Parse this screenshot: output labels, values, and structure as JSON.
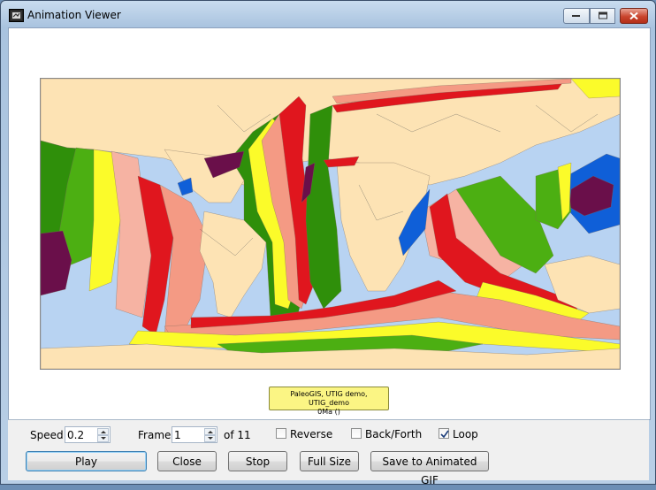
{
  "window": {
    "title": "Animation Viewer"
  },
  "map": {
    "caption_line1": "PaleoGIS, UTIG demo, UTIG_demo",
    "caption_line2": "0Ma  ()",
    "colors": {
      "ocean": "#b8d3f2",
      "continent": "#fde3b4",
      "red": "#e0161e",
      "salmon": "#f49a84",
      "pink": "#f6b3a3",
      "yellow": "#fbfb2a",
      "lightgreen": "#a6e04a",
      "green": "#4caf12",
      "darkgreen": "#2f8f0a",
      "blue": "#0f5fd8",
      "purple": "#6a0f4a"
    }
  },
  "controls": {
    "speed_label": "Speed:",
    "speed_value": "0.2",
    "frame_label": "Frame:",
    "frame_value": "1",
    "frame_total": "of 11",
    "reverse_label": "Reverse",
    "reverse_checked": false,
    "backforth_label": "Back/Forth",
    "backforth_checked": false,
    "loop_label": "Loop",
    "loop_checked": true
  },
  "buttons": {
    "play": "Play",
    "close": "Close",
    "stop": "Stop",
    "full_size": "Full Size",
    "save_gif": "Save to Animated GIF"
  }
}
